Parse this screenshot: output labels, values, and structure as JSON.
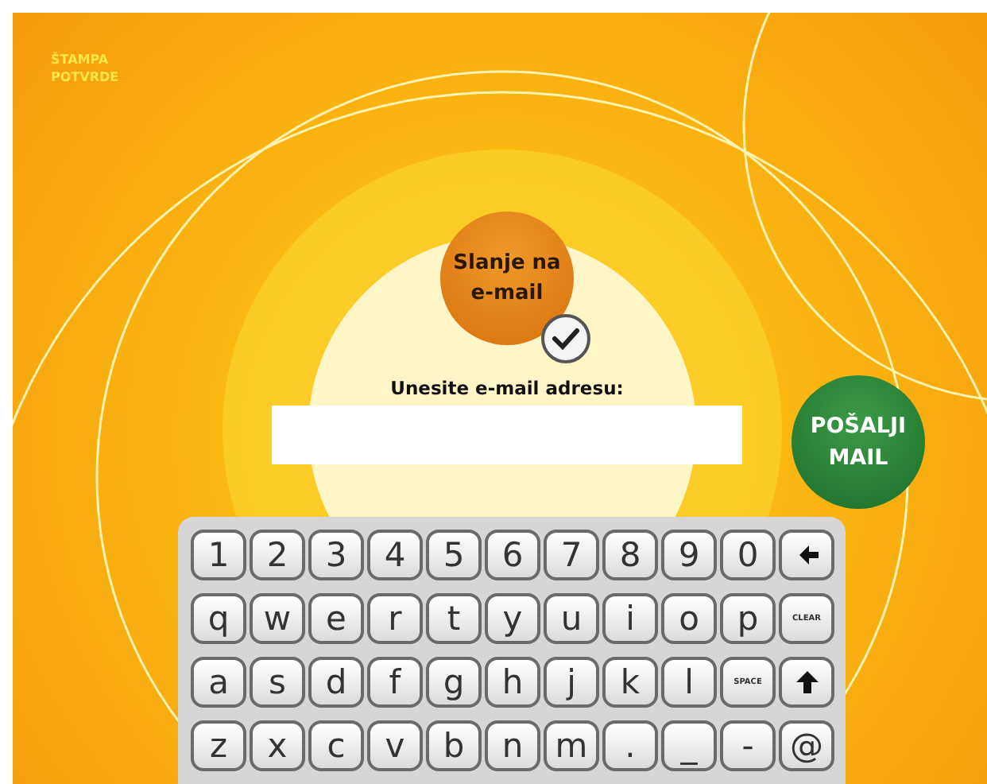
{
  "print_link": {
    "lines": [
      "ŠTAMPA",
      "POTVRDE"
    ]
  },
  "mail_option": {
    "label": "Slanje na e-mail",
    "checked": true
  },
  "email_prompt": "Unesite e-mail adresu:",
  "send_button": {
    "label": "POŠALJI MAIL"
  },
  "keyboard": {
    "rows": [
      [
        {
          "kind": "char",
          "label": "1"
        },
        {
          "kind": "char",
          "label": "2"
        },
        {
          "kind": "char",
          "label": "3"
        },
        {
          "kind": "char",
          "label": "4"
        },
        {
          "kind": "char",
          "label": "5"
        },
        {
          "kind": "char",
          "label": "6"
        },
        {
          "kind": "char",
          "label": "7"
        },
        {
          "kind": "char",
          "label": "8"
        },
        {
          "kind": "char",
          "label": "9"
        },
        {
          "kind": "char",
          "label": "0"
        },
        {
          "kind": "backspace"
        }
      ],
      [
        {
          "kind": "char",
          "label": "q"
        },
        {
          "kind": "char",
          "label": "w"
        },
        {
          "kind": "char",
          "label": "e"
        },
        {
          "kind": "char",
          "label": "r"
        },
        {
          "kind": "char",
          "label": "t"
        },
        {
          "kind": "char",
          "label": "y"
        },
        {
          "kind": "char",
          "label": "u"
        },
        {
          "kind": "char",
          "label": "i"
        },
        {
          "kind": "char",
          "label": "o"
        },
        {
          "kind": "char",
          "label": "p"
        },
        {
          "kind": "small",
          "label": "CLEAR"
        }
      ],
      [
        {
          "kind": "char",
          "label": "a"
        },
        {
          "kind": "char",
          "label": "s"
        },
        {
          "kind": "char",
          "label": "d"
        },
        {
          "kind": "char",
          "label": "f"
        },
        {
          "kind": "char",
          "label": "g"
        },
        {
          "kind": "char",
          "label": "h"
        },
        {
          "kind": "char",
          "label": "j"
        },
        {
          "kind": "char",
          "label": "k"
        },
        {
          "kind": "char",
          "label": "l"
        },
        {
          "kind": "small",
          "label": "SPACE"
        },
        {
          "kind": "shift"
        }
      ],
      [
        {
          "kind": "char",
          "label": "z"
        },
        {
          "kind": "char",
          "label": "x"
        },
        {
          "kind": "char",
          "label": "c"
        },
        {
          "kind": "char",
          "label": "v"
        },
        {
          "kind": "char",
          "label": "b"
        },
        {
          "kind": "char",
          "label": "n"
        },
        {
          "kind": "char",
          "label": "m"
        },
        {
          "kind": "char",
          "label": "."
        },
        {
          "kind": "char",
          "label": "_"
        },
        {
          "kind": "char",
          "label": "-"
        },
        {
          "kind": "char",
          "label": "@"
        }
      ]
    ]
  }
}
